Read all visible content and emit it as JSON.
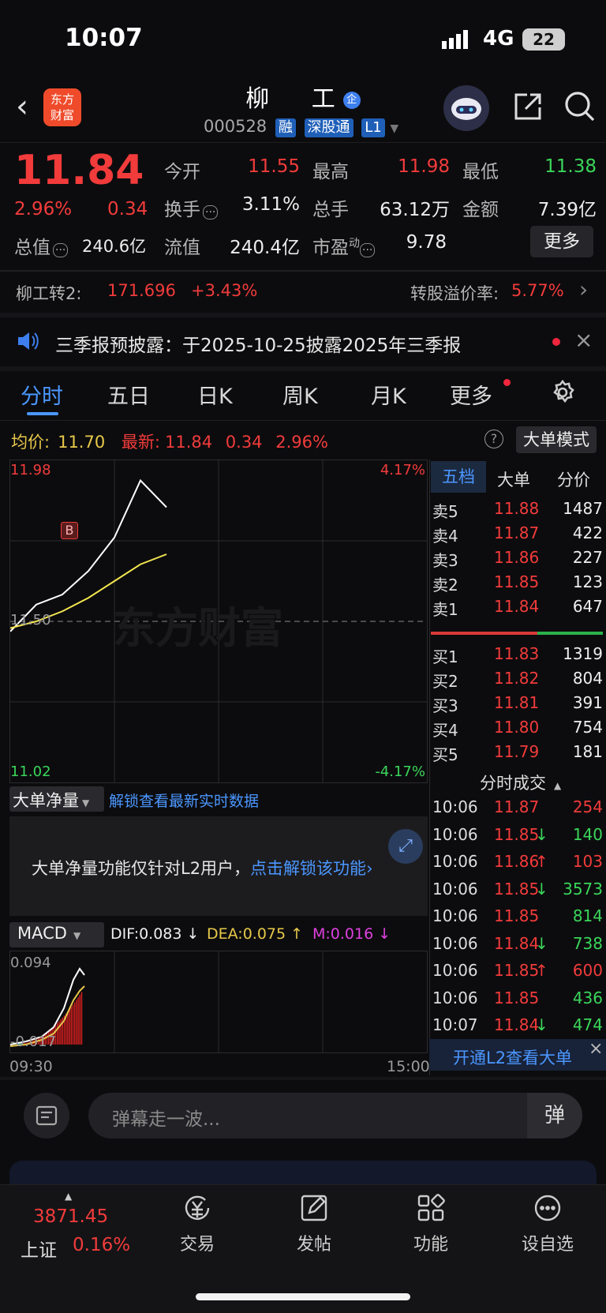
{
  "status": {
    "time": "10:07",
    "network": "4G",
    "battery": "22"
  },
  "nav": {
    "title": "柳 工",
    "badge_qi": "企",
    "code": "000528",
    "tags": [
      "融",
      "深股通",
      "L1"
    ]
  },
  "quote": {
    "price": "11.84",
    "pct": "2.96%",
    "chg": "0.34",
    "jk_lbl": "今开",
    "jk": "11.55",
    "zg_lbl": "最高",
    "zg": "11.98",
    "zd_lbl": "最低",
    "zd": "11.38",
    "hs_lbl": "换手",
    "hs": "3.11%",
    "zs_lbl": "总手",
    "zs": "63.12万",
    "je_lbl": "金额",
    "je": "7.39亿",
    "zz_lbl": "总值",
    "zz": "240.6亿",
    "lz_lbl": "流值",
    "lz": "240.4亿",
    "syl_lbl": "市盈",
    "syl_sup": "动",
    "syl": "9.78",
    "more": "更多"
  },
  "convert": {
    "name": "柳工转2:",
    "price": "171.696",
    "pct": "+3.43%",
    "premium_lbl": "转股溢价率:",
    "premium": "5.77%"
  },
  "notice": {
    "text": "三季报预披露：于2025-10-25披露2025年三季报"
  },
  "tabs": [
    "分时",
    "五日",
    "日K",
    "周K",
    "月K",
    "更多"
  ],
  "chart_info": {
    "avg_lbl": "均价:",
    "avg": "11.70",
    "latest_lbl": "最新:",
    "latest": "11.84",
    "chg": "0.34",
    "pct": "2.96%",
    "mode_btn": "大单模式"
  },
  "chart_axis": {
    "high": "11.98",
    "low": "11.02",
    "mid": "11.50",
    "high_pct": "4.17%",
    "low_pct": "-4.17%",
    "t_start": "09:30",
    "t_end": "15:00",
    "watermark": "东方财富",
    "b_marker": "B"
  },
  "chart_data": {
    "type": "line",
    "x": [
      "09:30",
      "09:31",
      "09:32",
      "09:33",
      "09:34",
      "09:35",
      "09:36"
    ],
    "series": [
      {
        "values": [
          11.47,
          11.55,
          11.58,
          11.65,
          11.75,
          11.92,
          11.84
        ]
      },
      {
        "values": [
          11.48,
          11.5,
          11.53,
          11.57,
          11.62,
          11.67,
          11.7
        ]
      }
    ],
    "ylim": [
      11.02,
      11.98
    ]
  },
  "orderbook": {
    "tabs": [
      "五档",
      "大单",
      "分价"
    ],
    "sells": [
      {
        "l": "卖5",
        "p": "11.88",
        "v": "1487"
      },
      {
        "l": "卖4",
        "p": "11.87",
        "v": "422"
      },
      {
        "l": "卖3",
        "p": "11.86",
        "v": "227"
      },
      {
        "l": "卖2",
        "p": "11.85",
        "v": "123"
      },
      {
        "l": "卖1",
        "p": "11.84",
        "v": "647"
      }
    ],
    "buys": [
      {
        "l": "买1",
        "p": "11.83",
        "v": "1319"
      },
      {
        "l": "买2",
        "p": "11.82",
        "v": "804"
      },
      {
        "l": "买3",
        "p": "11.81",
        "v": "391"
      },
      {
        "l": "买4",
        "p": "11.80",
        "v": "754"
      },
      {
        "l": "买5",
        "p": "11.79",
        "v": "181"
      }
    ]
  },
  "trades": {
    "title": "分时成交",
    "rows": [
      {
        "t": "10:06",
        "p": "11.87",
        "a": "",
        "v": "254"
      },
      {
        "t": "10:06",
        "p": "11.85",
        "a": "↓",
        "v": "140"
      },
      {
        "t": "10:06",
        "p": "11.86",
        "a": "↑",
        "v": "103"
      },
      {
        "t": "10:06",
        "p": "11.85",
        "a": "↓",
        "v": "3573"
      },
      {
        "t": "10:06",
        "p": "11.85",
        "a": "",
        "v": "814"
      },
      {
        "t": "10:06",
        "p": "11.84",
        "a": "↓",
        "v": "738"
      },
      {
        "t": "10:06",
        "p": "11.85",
        "a": "↑",
        "v": "600"
      },
      {
        "t": "10:06",
        "p": "11.85",
        "a": "",
        "v": "436"
      },
      {
        "t": "10:07",
        "p": "11.84",
        "a": "↓",
        "v": "474"
      }
    ],
    "l2_btn": "开通L2查看大单"
  },
  "dadan": {
    "select": "大单净量",
    "unlock": "解锁查看最新实时数据",
    "msg": "大单净量功能仅针对L2用户，",
    "link": "点击解锁该功能"
  },
  "macd": {
    "select": "MACD",
    "dif": "DIF:0.083 ↓",
    "dea": "DEA:0.075 ↑",
    "m": "M:0.016 ↓",
    "top": "0.094",
    "bottom": "-0.017"
  },
  "danmu": {
    "placeholder": "弹幕走一波..."
  },
  "bottom": {
    "index_val": "3871.45",
    "index_name": "上证",
    "index_pct": "0.16%",
    "items": [
      "交易",
      "发帖",
      "功能",
      "设自选"
    ]
  }
}
